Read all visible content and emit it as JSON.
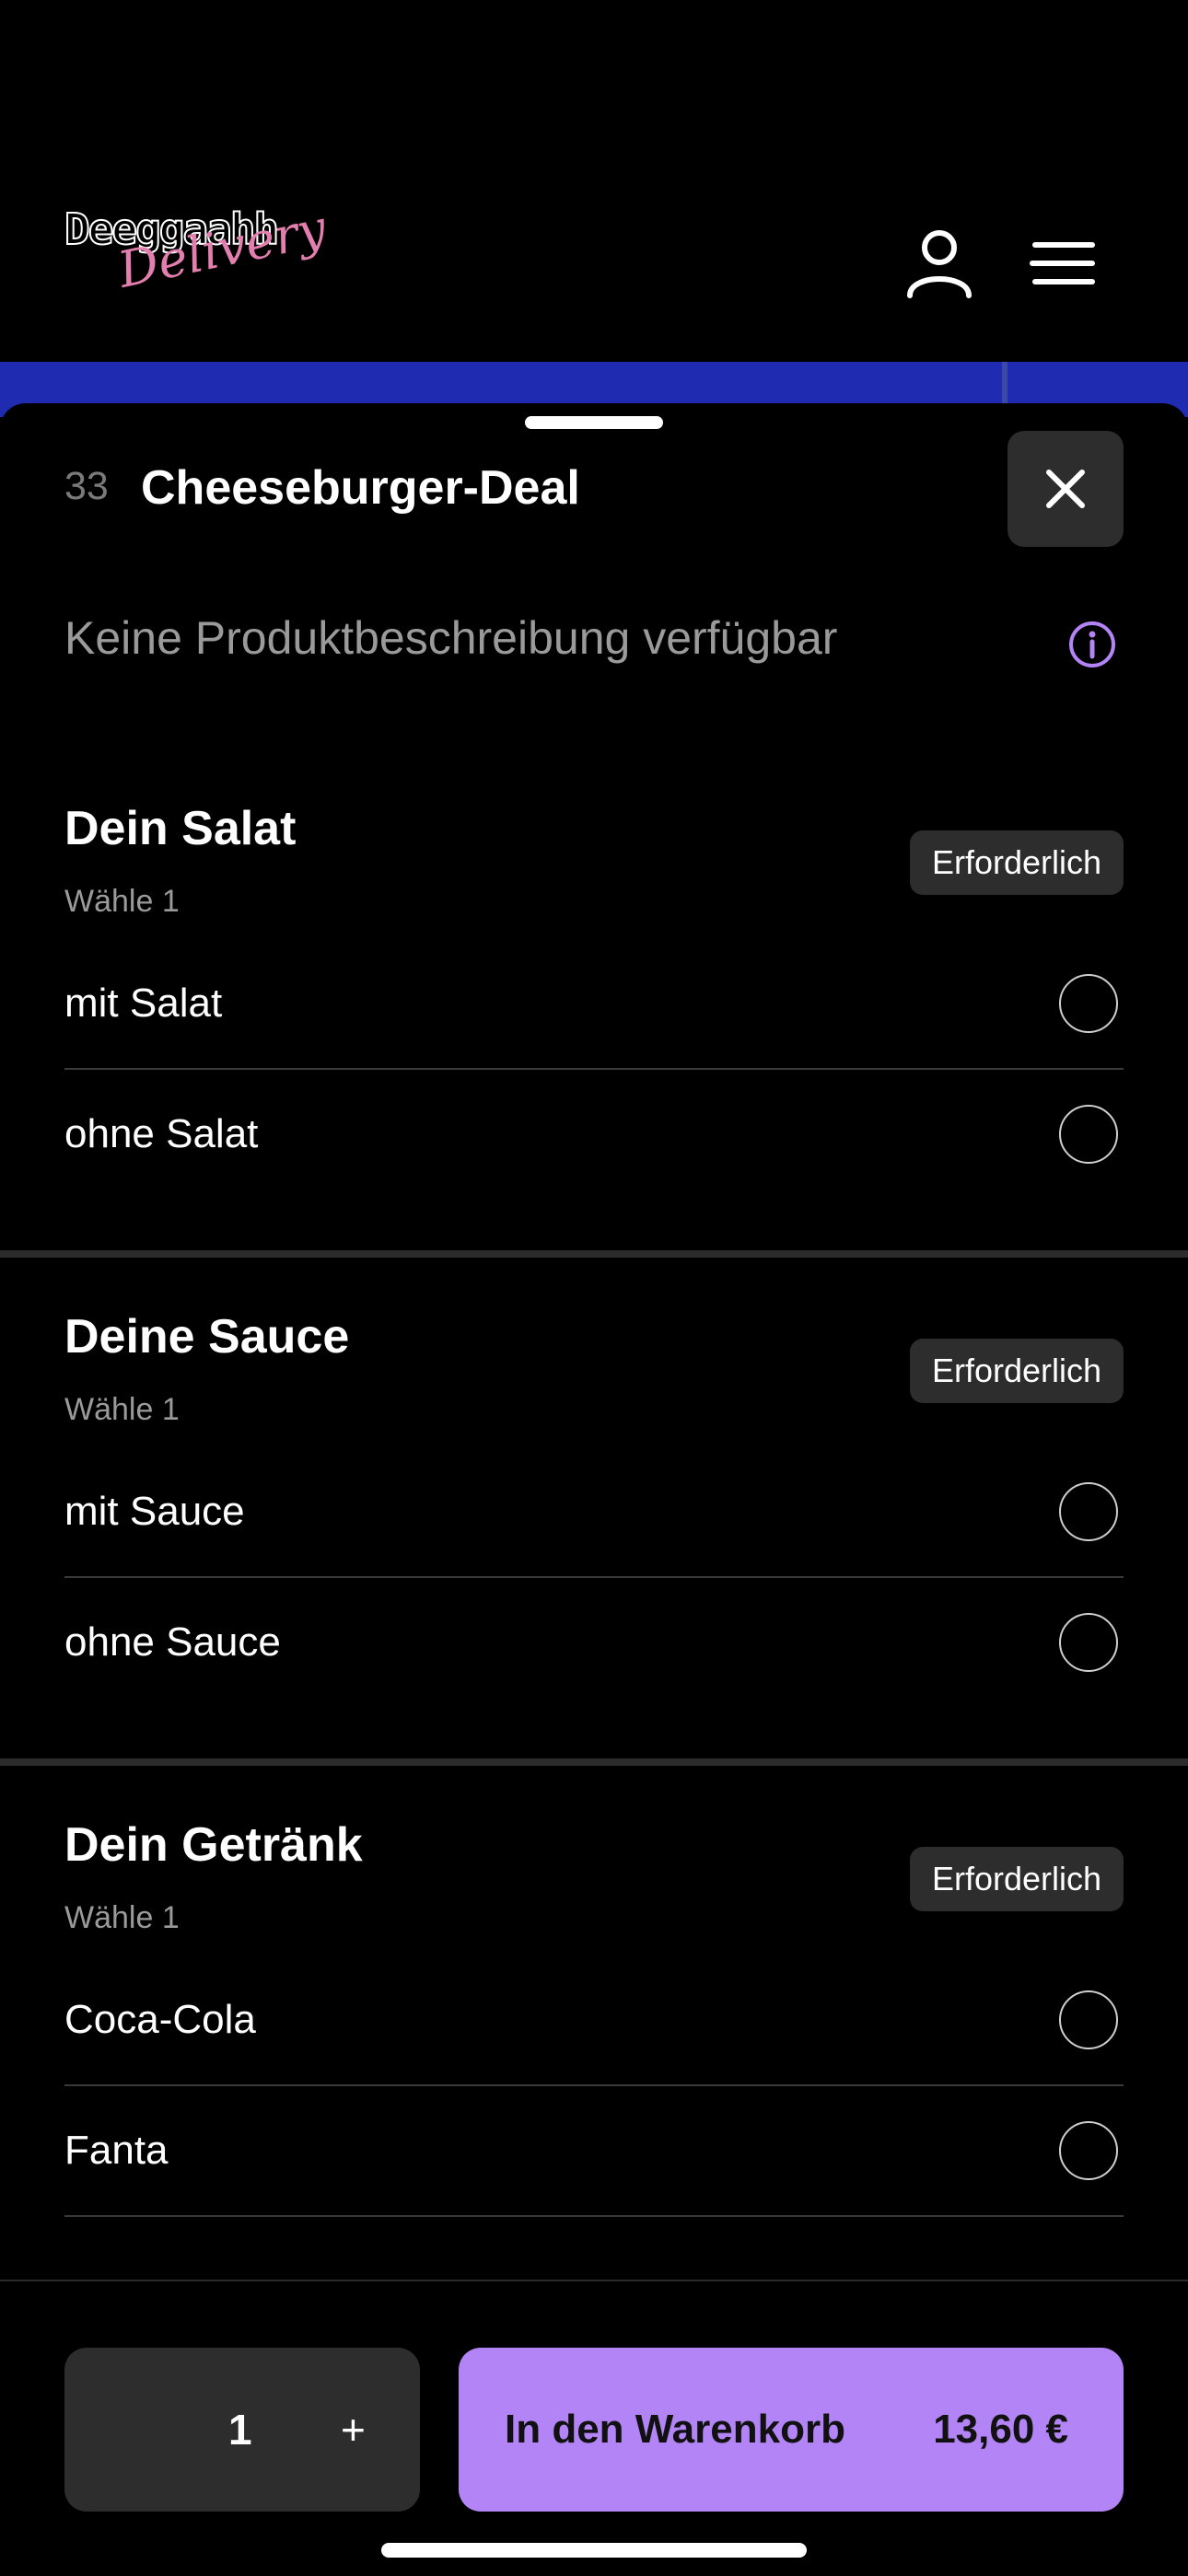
{
  "header": {
    "logo_word": "Deeggaahh",
    "logo_script": "Delivery",
    "icons": {
      "user": "user-icon",
      "menu": "menu-icon"
    }
  },
  "sheet": {
    "item_number": "33",
    "item_title": "Cheeseburger-Deal",
    "description": "Keine Produktbeschreibung verfügbar",
    "groups": [
      {
        "title": "Dein Salat",
        "subtitle": "Wähle 1",
        "badge": "Erforderlich",
        "options": [
          "mit Salat",
          "ohne Salat"
        ]
      },
      {
        "title": "Deine Sauce",
        "subtitle": "Wähle 1",
        "badge": "Erforderlich",
        "options": [
          "mit Sauce",
          "ohne Sauce"
        ]
      },
      {
        "title": "Dein Getränk",
        "subtitle": "Wähle 1",
        "badge": "Erforderlich",
        "options": [
          "Coca-Cola",
          "Fanta"
        ]
      }
    ]
  },
  "bottom_bar": {
    "quantity": "1",
    "plus": "+",
    "cart_label": "In den Warenkorb",
    "price": "13,60 €"
  },
  "colors": {
    "accent": "#b384f6",
    "background": "#000000",
    "chip": "#2d2d2d",
    "logo_pink": "#e27fae",
    "hero_blue": "#1f2bb0"
  }
}
